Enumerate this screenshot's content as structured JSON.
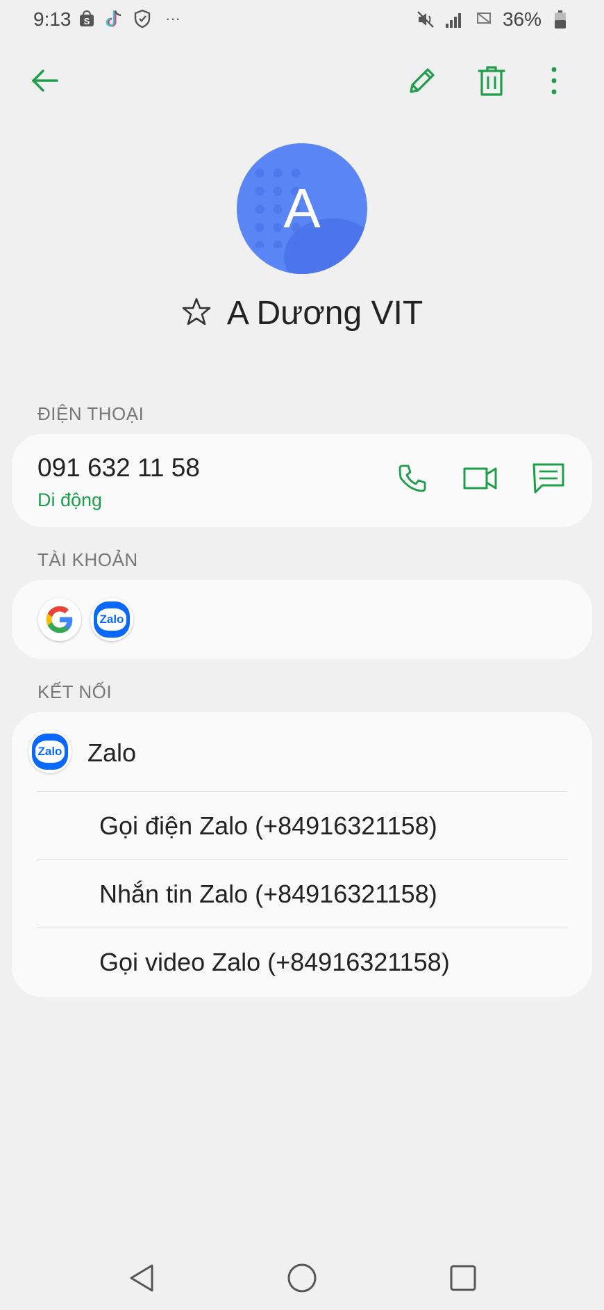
{
  "status_bar": {
    "time": "9:13",
    "left_icons": [
      "shopee-icon",
      "tiktok-icon",
      "shield-icon"
    ],
    "more": "···",
    "battery": "36%"
  },
  "app_bar": {
    "back_icon": "arrow-left-icon",
    "edit_icon": "pencil-icon",
    "delete_icon": "trash-icon",
    "menu_icon": "more-vert-icon",
    "accent": "#1e9e4a"
  },
  "contact": {
    "avatar_letter": "A",
    "avatar_color": "#5a86f5",
    "name": "A Dương VIT"
  },
  "phone_section": {
    "label": "ĐIỆN THOẠI",
    "number": "091 632 11 58",
    "type": "Di động",
    "actions": [
      "phone-icon",
      "video-icon",
      "message-icon"
    ]
  },
  "accounts_section": {
    "label": "TÀI KHOẢN",
    "accounts": [
      "google-icon",
      "zalo-icon"
    ],
    "zalo_text": "Zalo"
  },
  "connections_section": {
    "label": "KẾT NỐI",
    "app_name": "Zalo",
    "app_logo_text": "Zalo",
    "items": [
      {
        "label": "Gọi điện Zalo (+84916321158)"
      },
      {
        "label": "Nhắn tin Zalo (+84916321158)"
      },
      {
        "label": "Gọi video Zalo (+84916321158)"
      }
    ]
  },
  "nav_bar": {
    "buttons": [
      "back-triangle-icon",
      "home-circle-icon",
      "recents-square-icon"
    ]
  }
}
